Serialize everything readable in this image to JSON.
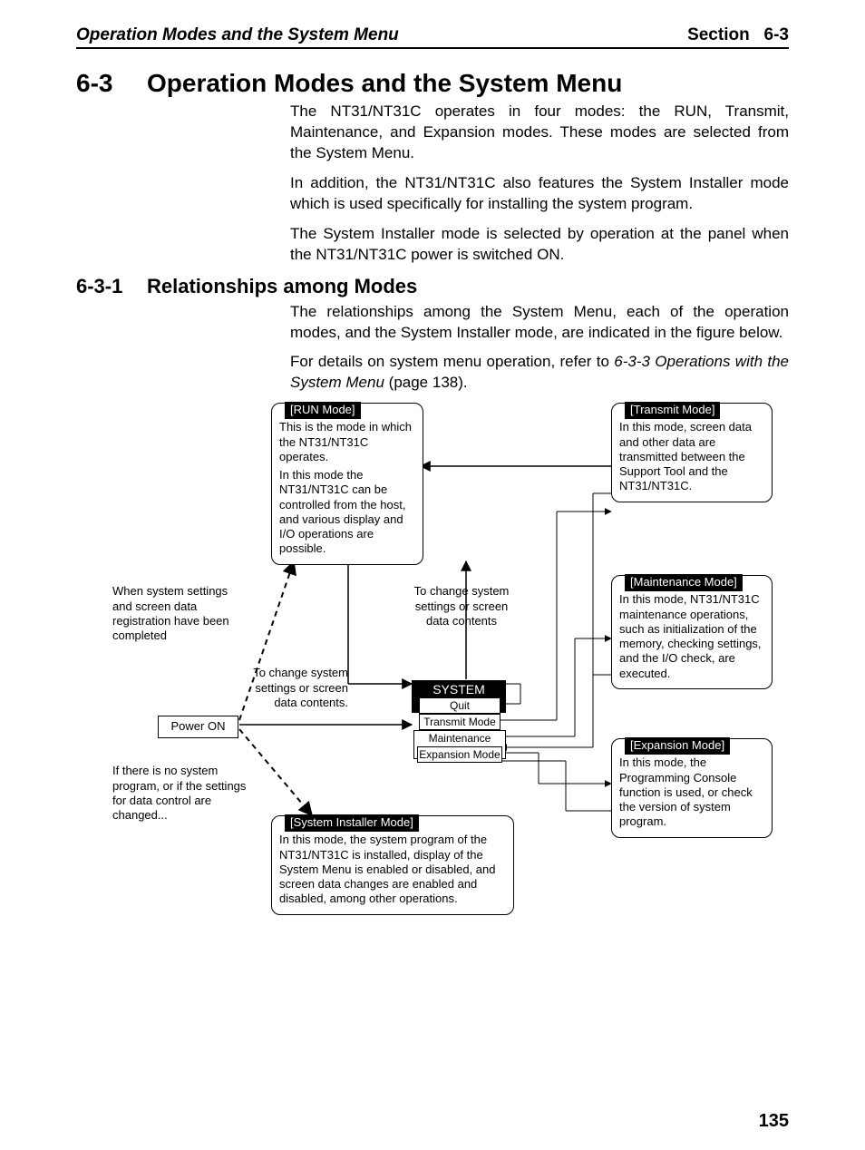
{
  "header": {
    "left": "Operation Modes and the System Menu",
    "right_label": "Section",
    "right_num": "6-3"
  },
  "section": {
    "num": "6-3",
    "title": "Operation Modes and the System Menu",
    "p1": "The NT31/NT31C operates in four modes: the RUN, Transmit, Maintenance, and Expansion modes. These modes are selected from the System Menu.",
    "p2": "In addition, the NT31/NT31C also features the System Installer mode which is used specifically for installing the system program.",
    "p3": "The System Installer mode is selected by operation at the panel when the NT31/NT31C power is switched ON."
  },
  "subsection": {
    "num": "6-3-1",
    "title": "Relationships among Modes",
    "p1": "The relationships among the System Menu, each of the operation modes, and the System Installer mode, are indicated in the figure below.",
    "p2a": "For details on system menu operation, refer to ",
    "p2b": "6-3-3 Operations with the System Menu",
    "p2c": " (page 138)."
  },
  "diagram": {
    "run": {
      "label": "[RUN Mode]",
      "t1": "This is the mode in which the NT31/NT31C operates.",
      "t2": "In this mode the NT31/NT31C can be controlled from the host, and various display and I/O operations are possible."
    },
    "transmit": {
      "label": "[Transmit Mode]",
      "t": "In this mode, screen data and other data are transmitted between the Support Tool and the NT31/NT31C."
    },
    "maintenance": {
      "label": "[Maintenance Mode]",
      "t": "In this mode, NT31/NT31C maintenance operations, such as initialization of the memory, checking settings, and the I/O check, are executed."
    },
    "expansion": {
      "label": "[Expansion Mode]",
      "t": "In this mode, the Programming Console function is used, or check the version of system program."
    },
    "installer": {
      "label": "[System Installer Mode]",
      "t": "In this mode, the system program of the NT31/NT31C is installed, display of the System Menu is enabled or disabled, and screen data changes are enabled and disabled, among other operations."
    },
    "poweron": "Power ON",
    "note_left_top": "When system settings and screen data registration have been completed",
    "note_left_mid": "To change system settings or screen data contents.",
    "note_center": "To change system settings or screen data contents",
    "note_left_bottom": "If there is no system program, or if the settings for data control are changed...",
    "menu": {
      "header": "SYSTEM MENU",
      "r1": "Quit",
      "r2": "Transmit Mode",
      "r3": "Maintenance Mode",
      "r4": "Expansion Mode"
    }
  },
  "pagenum": "135"
}
